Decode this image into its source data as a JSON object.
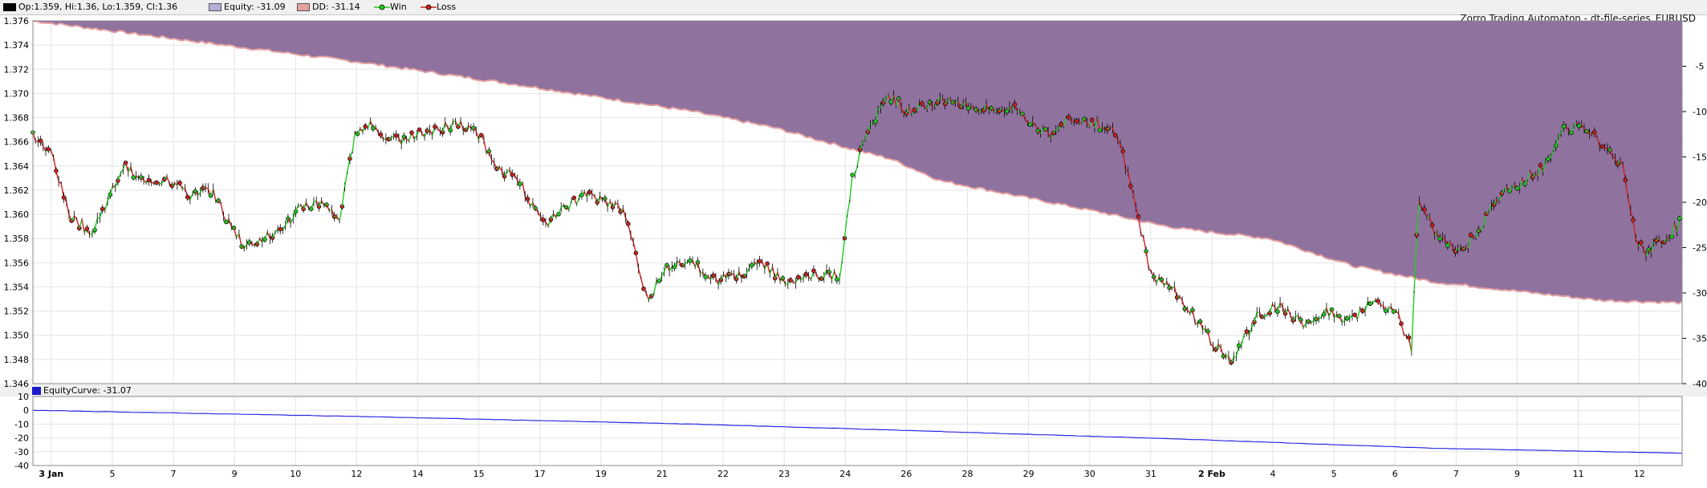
{
  "header": {
    "ohlc": "Op:1.359, Hi:1.36, Lo:1.359, Cl:1.36",
    "equity": "Equity: -31.09",
    "dd": "DD: -31.14",
    "win": "Win",
    "loss": "Loss"
  },
  "title": "Zorro Trading Automaton - dt-file-series_EURUSD",
  "sub_header": "EquityCurve: -31.07",
  "colors": {
    "equity_fill": "#8a6a9a",
    "dd_line": "#e4a0a0",
    "win": "#22cc22",
    "loss": "#cc2222",
    "equity_curve": "#2a2ae6",
    "price": "#000000"
  },
  "chart_data": [
    {
      "type": "line",
      "panel": "price",
      "y_left_ticks": [
        "1.376",
        "1.374",
        "1.372",
        "1.370",
        "1.368",
        "1.366",
        "1.364",
        "1.362",
        "1.360",
        "1.358",
        "1.356",
        "1.354",
        "1.352",
        "1.350",
        "1.348",
        "1.346"
      ],
      "ylim": [
        1.346,
        1.376
      ],
      "y_right_ticks": [
        "-5",
        "-10",
        "-15",
        "-20",
        "-25",
        "-30",
        "-35",
        "-40"
      ],
      "y2lim": [
        -40,
        0
      ],
      "x_ticks": [
        "3 Jan",
        "5",
        "7",
        "9",
        "10",
        "12",
        "14",
        "15",
        "17",
        "19",
        "21",
        "22",
        "23",
        "24",
        "26",
        "28",
        "29",
        "30",
        "31",
        "2 Feb",
        "4",
        "5",
        "6",
        "7",
        "9",
        "11",
        "12"
      ],
      "x_ticks_bold": [
        "3 Jan",
        "2 Feb"
      ],
      "price_keypoints": [
        [
          0.0,
          1.3665
        ],
        [
          0.012,
          1.365
        ],
        [
          0.022,
          1.36
        ],
        [
          0.035,
          1.3585
        ],
        [
          0.045,
          1.361
        ],
        [
          0.055,
          1.364
        ],
        [
          0.068,
          1.3625
        ],
        [
          0.082,
          1.363
        ],
        [
          0.095,
          1.3615
        ],
        [
          0.108,
          1.362
        ],
        [
          0.118,
          1.3595
        ],
        [
          0.128,
          1.3575
        ],
        [
          0.14,
          1.358
        ],
        [
          0.152,
          1.359
        ],
        [
          0.162,
          1.3605
        ],
        [
          0.174,
          1.361
        ],
        [
          0.186,
          1.3595
        ],
        [
          0.195,
          1.3665
        ],
        [
          0.205,
          1.3675
        ],
        [
          0.218,
          1.366
        ],
        [
          0.232,
          1.3665
        ],
        [
          0.245,
          1.367
        ],
        [
          0.258,
          1.3675
        ],
        [
          0.27,
          1.3665
        ],
        [
          0.282,
          1.364
        ],
        [
          0.296,
          1.3625
        ],
        [
          0.31,
          1.359
        ],
        [
          0.322,
          1.3605
        ],
        [
          0.335,
          1.3615
        ],
        [
          0.348,
          1.361
        ],
        [
          0.36,
          1.36
        ],
        [
          0.372,
          1.353
        ],
        [
          0.385,
          1.3555
        ],
        [
          0.398,
          1.3565
        ],
        [
          0.412,
          1.3545
        ],
        [
          0.428,
          1.355
        ],
        [
          0.442,
          1.356
        ],
        [
          0.456,
          1.3545
        ],
        [
          0.47,
          1.355
        ],
        [
          0.49,
          1.355
        ],
        [
          0.496,
          1.3625
        ],
        [
          0.505,
          1.3665
        ],
        [
          0.518,
          1.37
        ],
        [
          0.53,
          1.3685
        ],
        [
          0.54,
          1.369
        ],
        [
          0.555,
          1.3695
        ],
        [
          0.568,
          1.369
        ],
        [
          0.582,
          1.3685
        ],
        [
          0.594,
          1.369
        ],
        [
          0.606,
          1.3675
        ],
        [
          0.618,
          1.3665
        ],
        [
          0.63,
          1.368
        ],
        [
          0.645,
          1.3675
        ],
        [
          0.658,
          1.3665
        ],
        [
          0.668,
          1.361
        ],
        [
          0.678,
          1.355
        ],
        [
          0.69,
          1.354
        ],
        [
          0.702,
          1.352
        ],
        [
          0.715,
          1.3495
        ],
        [
          0.728,
          1.348
        ],
        [
          0.742,
          1.3515
        ],
        [
          0.756,
          1.3525
        ],
        [
          0.77,
          1.351
        ],
        [
          0.784,
          1.352
        ],
        [
          0.798,
          1.351
        ],
        [
          0.812,
          1.353
        ],
        [
          0.826,
          1.352
        ],
        [
          0.836,
          1.349
        ],
        [
          0.84,
          1.3615
        ],
        [
          0.852,
          1.358
        ],
        [
          0.866,
          1.357
        ],
        [
          0.876,
          1.3585
        ],
        [
          0.888,
          1.3615
        ],
        [
          0.902,
          1.3625
        ],
        [
          0.916,
          1.364
        ],
        [
          0.928,
          1.367
        ],
        [
          0.94,
          1.3675
        ],
        [
          0.952,
          1.3655
        ],
        [
          0.964,
          1.364
        ],
        [
          0.972,
          1.358
        ],
        [
          0.978,
          1.357
        ],
        [
          0.99,
          1.358
        ],
        [
          1.0,
          1.3595
        ]
      ],
      "equity_keypoints": [
        [
          0.0,
          0
        ],
        [
          0.1,
          -2.3
        ],
        [
          0.2,
          -4.6
        ],
        [
          0.3,
          -7.2
        ],
        [
          0.4,
          -10.0
        ],
        [
          0.45,
          -11.8
        ],
        [
          0.5,
          -14.3
        ],
        [
          0.52,
          -15.2
        ],
        [
          0.55,
          -17.6
        ],
        [
          0.6,
          -19.4
        ],
        [
          0.65,
          -21.2
        ],
        [
          0.68,
          -22.4
        ],
        [
          0.7,
          -23.0
        ],
        [
          0.75,
          -24.0
        ],
        [
          0.8,
          -27.0
        ],
        [
          0.85,
          -28.8
        ],
        [
          0.9,
          -29.8
        ],
        [
          0.95,
          -30.8
        ],
        [
          1.0,
          -31.09
        ]
      ]
    },
    {
      "type": "line",
      "panel": "equity_curve",
      "y_ticks": [
        "10",
        "0",
        "-10",
        "-20",
        "-30",
        "-40"
      ],
      "ylim": [
        -40,
        10
      ],
      "values_keypoints": [
        [
          0.0,
          0
        ],
        [
          0.2,
          -4.5
        ],
        [
          0.4,
          -10
        ],
        [
          0.5,
          -13.5
        ],
        [
          0.7,
          -21
        ],
        [
          0.85,
          -27.5
        ],
        [
          1.0,
          -31.07
        ]
      ]
    }
  ]
}
